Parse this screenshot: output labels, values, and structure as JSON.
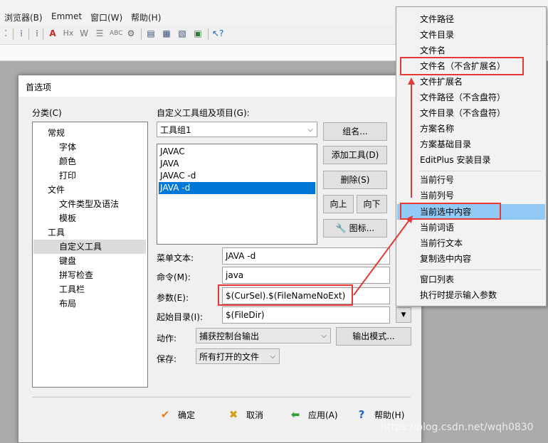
{
  "menubar": {
    "items": [
      "浏览器(B)",
      "Emmet",
      "窗口(W)",
      "帮助(H)"
    ]
  },
  "toolbar": {
    "icons": [
      "spell-check-icon",
      "hx-icon",
      "strike-icon",
      "list-icon",
      "abc-icon",
      "gear-icon",
      "panel-icon",
      "panel2-icon",
      "note-icon",
      "image-icon",
      "help-cursor-icon"
    ]
  },
  "dialog": {
    "title": "首选项",
    "category_label": "分类(C)",
    "categories": [
      {
        "label": "常规",
        "level": 0
      },
      {
        "label": "字体",
        "level": 1
      },
      {
        "label": "颜色",
        "level": 1
      },
      {
        "label": "打印",
        "level": 1
      },
      {
        "label": "文件",
        "level": 0
      },
      {
        "label": "文件类型及语法",
        "level": 1
      },
      {
        "label": "模板",
        "level": 1
      },
      {
        "label": "工具",
        "level": 0
      },
      {
        "label": "自定义工具",
        "level": 1,
        "selected": true
      },
      {
        "label": "键盘",
        "level": 1
      },
      {
        "label": "拼写检查",
        "level": 1
      },
      {
        "label": "工具栏",
        "level": 1
      },
      {
        "label": "布局",
        "level": 1
      }
    ],
    "group_label": "自定义工具组及项目(G):",
    "group_combo": "工具组1",
    "tools": [
      {
        "label": "JAVAC"
      },
      {
        "label": "JAVA"
      },
      {
        "label": "JAVAC -d"
      },
      {
        "label": "JAVA -d",
        "selected": true
      }
    ],
    "buttons": {
      "group_name": "组名...",
      "add_tool": "添加工具(D)",
      "delete": "删除(S)",
      "move_up": "向上",
      "move_down": "向下",
      "icon": "图标...",
      "output_mode": "输出模式..."
    },
    "fields": {
      "menu_text_label": "菜单文本:",
      "menu_text_value": "JAVA -d",
      "command_label": "命令(M):",
      "command_value": "java",
      "args_label": "参数(E):",
      "args_value": "$(CurSel).$(FileNameNoExt)",
      "start_dir_label": "起始目录(I):",
      "start_dir_value": "$(FileDir)",
      "action_label": "动作:",
      "action_value": "捕获控制台输出",
      "save_label": "保存:",
      "save_value": "所有打开的文件"
    },
    "footer": {
      "ok": "确定",
      "cancel": "取消",
      "apply": "应用(A)",
      "help": "帮助(H)"
    }
  },
  "popup_menu": {
    "group1": [
      "文件路径",
      "文件目录",
      "文件名",
      "文件名（不含扩展名）",
      "文件扩展名",
      "文件路径（不含盘符）",
      "文件目录（不含盘符）",
      "方案名称",
      "方案基础目录",
      "EditPlus 安装目录"
    ],
    "group2": [
      "当前行号",
      "当前列号",
      "当前选中内容",
      "当前词语",
      "当前行文本",
      "复制选中内容"
    ],
    "group3": [
      "窗口列表",
      "执行时提示输入参数"
    ],
    "highlighted": "当前选中内容"
  },
  "annotation_color": "#e53935",
  "watermark": "https://blog.csdn.net/wqh0830"
}
